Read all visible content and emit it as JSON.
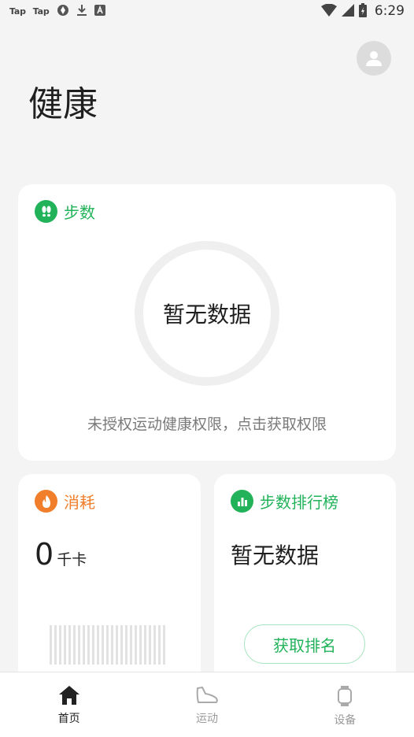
{
  "status_bar": {
    "left_items": [
      "Tap",
      "Tap"
    ],
    "time": "6:29",
    "icons": [
      "tap-app-icon",
      "tap-app-icon",
      "sync-icon",
      "download-icon",
      "a-badge-icon",
      "wifi-icon",
      "signal-icon",
      "battery-icon"
    ]
  },
  "header": {
    "title": "健康",
    "avatar_icon": "person-icon"
  },
  "steps_card": {
    "title": "步数",
    "icon": "footprints-icon",
    "center_text": "暂无数据",
    "hint": "未授权运动健康权限，点击获取权限"
  },
  "consume_card": {
    "title": "消耗",
    "icon": "flame-icon",
    "value": "0",
    "unit": "千卡"
  },
  "rank_card": {
    "title": "步数排行榜",
    "icon": "bar-chart-icon",
    "empty_text": "暂无数据",
    "button_label": "获取排名"
  },
  "tabbar": {
    "items": [
      {
        "label": "首页",
        "icon": "home-icon",
        "active": true
      },
      {
        "label": "运动",
        "icon": "shoe-icon",
        "active": false
      },
      {
        "label": "设备",
        "icon": "watch-icon",
        "active": false
      }
    ]
  },
  "colors": {
    "accent_green": "#22b35a",
    "accent_orange": "#f07e2a",
    "background": "#f4f4f4"
  }
}
